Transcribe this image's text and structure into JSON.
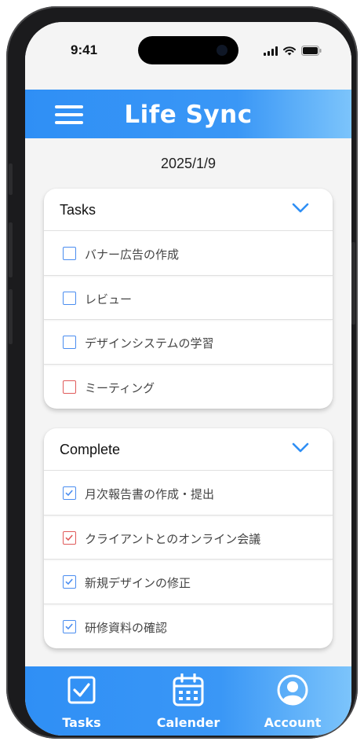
{
  "status_bar": {
    "time": "9:41"
  },
  "header": {
    "title": "Life Sync"
  },
  "date": "2025/1/9",
  "tasks_card": {
    "title": "Tasks",
    "items": [
      {
        "label": "バナー広告の作成",
        "checked": false,
        "color": "#4a8df0"
      },
      {
        "label": "レビュー",
        "checked": false,
        "color": "#4a8df0"
      },
      {
        "label": "デザインシステムの学習",
        "checked": false,
        "color": "#4a8df0"
      },
      {
        "label": "ミーティング",
        "checked": false,
        "color": "#e05a5a"
      }
    ]
  },
  "complete_card": {
    "title": "Complete",
    "items": [
      {
        "label": "月次報告書の作成・提出",
        "checked": true,
        "color": "#4a8df0"
      },
      {
        "label": "クライアントとのオンライン会議",
        "checked": true,
        "color": "#e05a5a"
      },
      {
        "label": "新規デザインの修正",
        "checked": true,
        "color": "#4a8df0"
      },
      {
        "label": "研修資料の確認",
        "checked": true,
        "color": "#4a8df0"
      }
    ]
  },
  "tab_bar": {
    "tabs": [
      {
        "label": "Tasks",
        "icon": "checkbox-icon"
      },
      {
        "label": "Calender",
        "icon": "calendar-icon"
      },
      {
        "label": "Account",
        "icon": "account-icon"
      }
    ]
  },
  "colors": {
    "accent": "#2f8ff5",
    "accent_light": "#7cc4fb",
    "alert": "#e05a5a"
  }
}
